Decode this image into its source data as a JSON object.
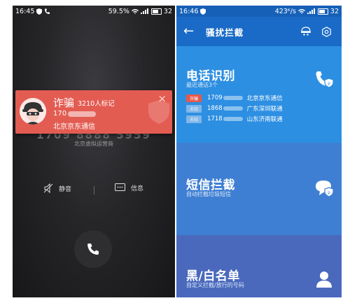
{
  "left_phone": {
    "status_bar": {
      "time": "16:45",
      "battery_pct": "59.5",
      "signal_text": "32"
    },
    "under_card": {
      "number": "1709 8888 5959",
      "carrier": "北京虚拟运营商"
    },
    "alert": {
      "label": "诈骗",
      "count": "3210人标记",
      "number": "170",
      "carrier": "北京京东通信",
      "close": "×"
    },
    "actions": {
      "mute": "静音",
      "message": "信息"
    }
  },
  "right_phone": {
    "status_bar": {
      "time": "16:46",
      "speed": "423",
      "battery_text": "32"
    },
    "header": {
      "back": "←",
      "title": "骚扰拦截"
    },
    "call_id": {
      "title": "电话识别",
      "subtitle": "最近通话3个",
      "calls": [
        {
          "tag": "诈骗",
          "tag_color": "#e45a4c",
          "number": "1709",
          "carrier": "北京京东通信"
        },
        {
          "tag": "未知",
          "tag_color": "#7fb6ea",
          "number": "1868",
          "carrier": "广东深圳联通"
        },
        {
          "tag": "未知",
          "tag_color": "#7fb6ea",
          "number": "1718",
          "carrier": "山东济南联通"
        }
      ]
    },
    "sms_block": {
      "title": "短信拦截",
      "subtitle": "自动拦截垃圾短信"
    },
    "blacklist": {
      "title": "黑/白名单",
      "subtitle": "自定义拦截/放行的号码"
    }
  },
  "colors": {
    "alert_red": "#e35c52",
    "header_blue": "#1a6bc7",
    "sec1": "#2d8fe2",
    "sec2": "#3f7fd3",
    "sec3": "#4a69bd"
  }
}
